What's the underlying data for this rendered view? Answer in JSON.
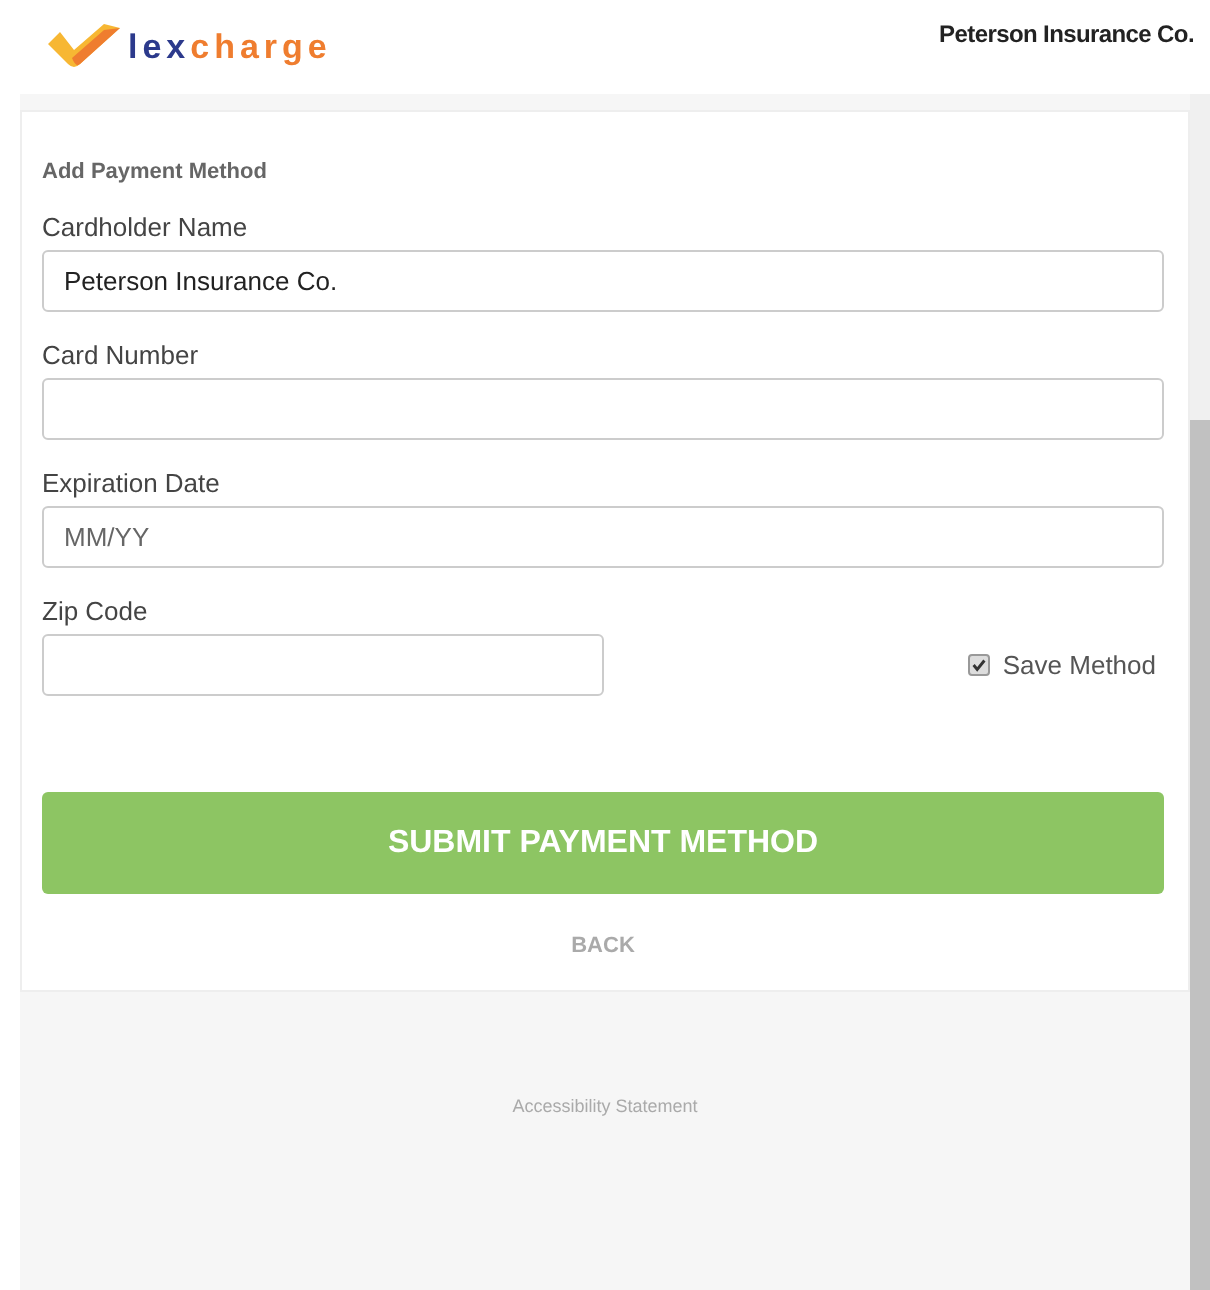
{
  "header": {
    "logo": {
      "text_1": "lex",
      "text_2": "charge"
    },
    "account_name": "Peterson Insurance Co."
  },
  "form": {
    "title": "Add Payment Method",
    "fields": [
      {
        "label": "Cardholder Name",
        "value": "Peterson Insurance Co."
      },
      {
        "label": "Card Number"
      },
      {
        "label": "Expiration Date",
        "placeholder": "MM/YY"
      }
    ],
    "zip": {
      "label": "Zip Code"
    },
    "save_method": {
      "label": "Save Method",
      "checked": true
    },
    "submit_button": "SUBMIT PAYMENT METHOD",
    "back_link": "BACK"
  },
  "footer": {
    "link": "Accessibility Statement"
  }
}
